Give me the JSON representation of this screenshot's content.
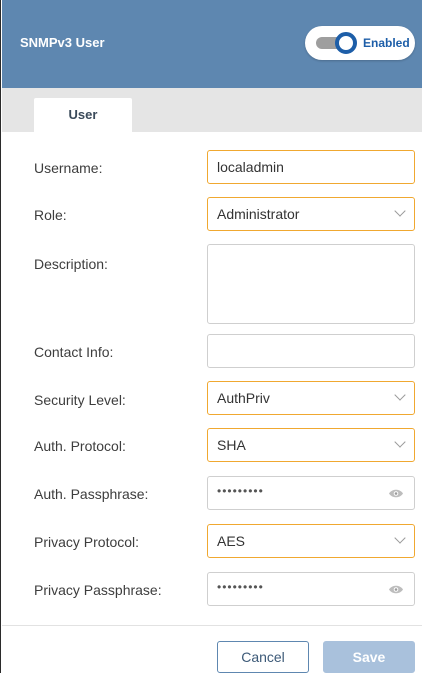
{
  "header": {
    "title": "SNMPv3 User",
    "toggle_label": "Enabled",
    "toggle_on": true,
    "color": "#5e87b0"
  },
  "tabs": [
    {
      "label": "User",
      "active": true
    }
  ],
  "form": {
    "username": {
      "label": "Username:",
      "value": "localadmin"
    },
    "role": {
      "label": "Role:",
      "value": "Administrator"
    },
    "description": {
      "label": "Description:",
      "value": ""
    },
    "contact_info": {
      "label": "Contact Info:",
      "value": ""
    },
    "security_level": {
      "label": "Security Level:",
      "value": "AuthPriv"
    },
    "auth_protocol": {
      "label": "Auth. Protocol:",
      "value": "SHA"
    },
    "auth_passphrase": {
      "label": "Auth. Passphrase:",
      "value": "•••••••••"
    },
    "privacy_protocol": {
      "label": "Privacy Protocol:",
      "value": "AES"
    },
    "privacy_passphrase": {
      "label": "Privacy Passphrase:",
      "value": "•••••••••"
    }
  },
  "footer": {
    "cancel_label": "Cancel",
    "save_label": "Save"
  },
  "icons": {
    "dropdown": "chevron-down-icon",
    "reveal": "eye-icon"
  },
  "colors": {
    "focus_border": "#f0a830",
    "accent": "#1d5ea8"
  }
}
